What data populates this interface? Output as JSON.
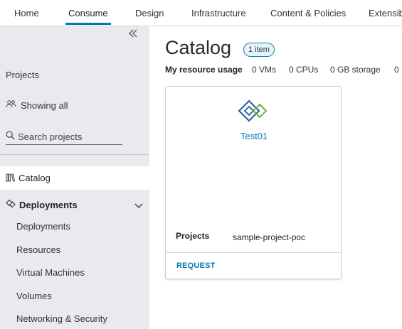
{
  "topnav": {
    "tabs": [
      {
        "label": "Home",
        "active": false
      },
      {
        "label": "Consume",
        "active": true
      },
      {
        "label": "Design",
        "active": false
      },
      {
        "label": "Infrastructure",
        "active": false
      },
      {
        "label": "Content & Policies",
        "active": false
      },
      {
        "label": "Extensib",
        "active": false
      }
    ]
  },
  "sidebar": {
    "collapse_icon": "double-chevron-left-icon",
    "projects_label": "Projects",
    "showing_label": "Showing all",
    "search_placeholder": "Search projects",
    "catalog_label": "Catalog",
    "deployments_label": "Deployments",
    "deployments_items": [
      "Deployments",
      "Resources",
      "Virtual Machines",
      "Volumes",
      "Networking & Security"
    ]
  },
  "main": {
    "title": "Catalog",
    "badge": "1 item",
    "usage": {
      "label": "My resource usage",
      "vms": "0 VMs",
      "cpus": "0 CPUs",
      "storage": "0 GB storage",
      "more": "0"
    },
    "card": {
      "name": "Test01",
      "projects_label": "Projects",
      "projects_value": "sample-project-poc",
      "action": "REQUEST"
    }
  },
  "colors": {
    "accent": "#0079b8",
    "sidebar_bg": "#e8eaed",
    "logo_blue": "#1d5c9e",
    "logo_green": "#62b433"
  }
}
